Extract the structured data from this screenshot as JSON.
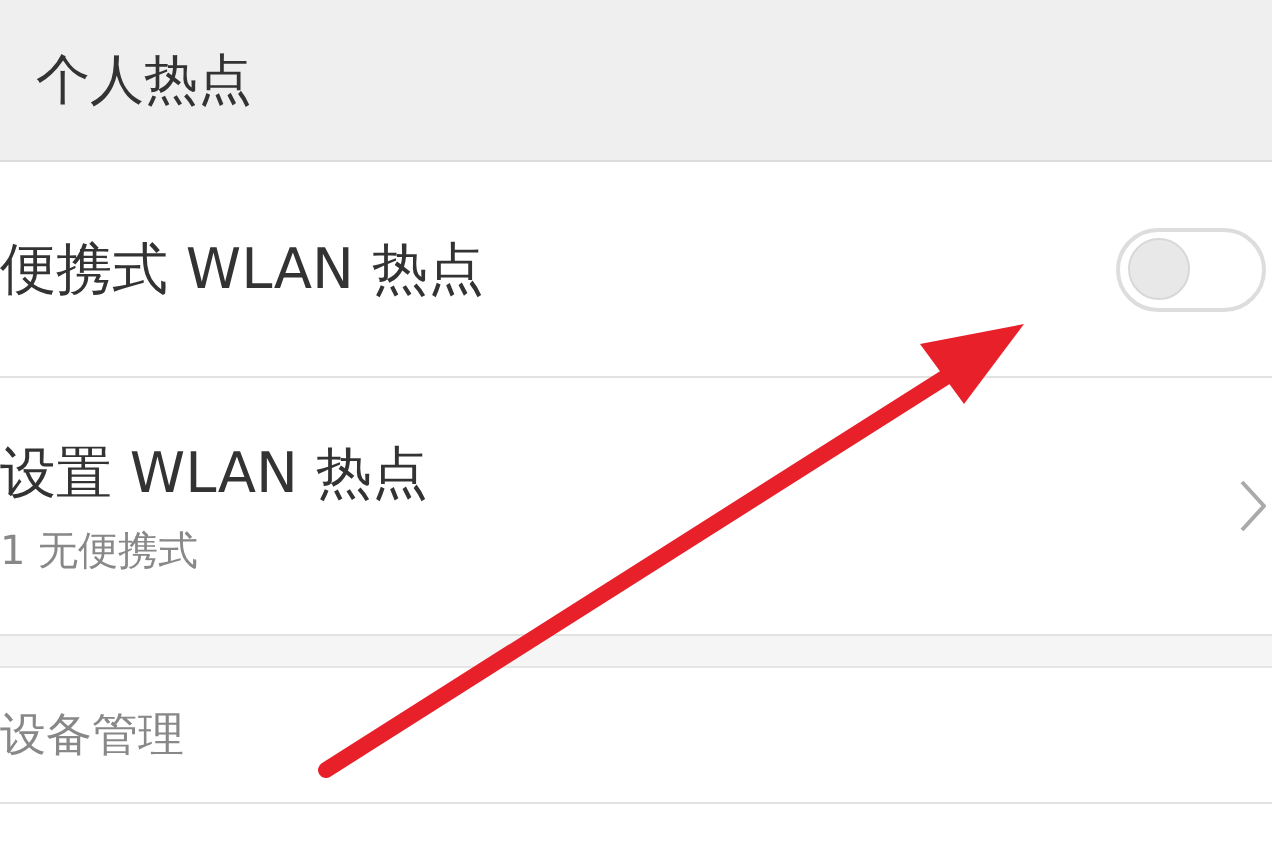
{
  "header": {
    "title": "个人热点"
  },
  "rows": [
    {
      "kind": "toggle",
      "title": "便携式 WLAN 热点",
      "on": false
    },
    {
      "kind": "link",
      "title": "设置 WLAN 热点",
      "subtitle": "1 无便携式"
    },
    {
      "kind": "gap"
    },
    {
      "kind": "plain",
      "title": "设备管理"
    }
  ]
}
